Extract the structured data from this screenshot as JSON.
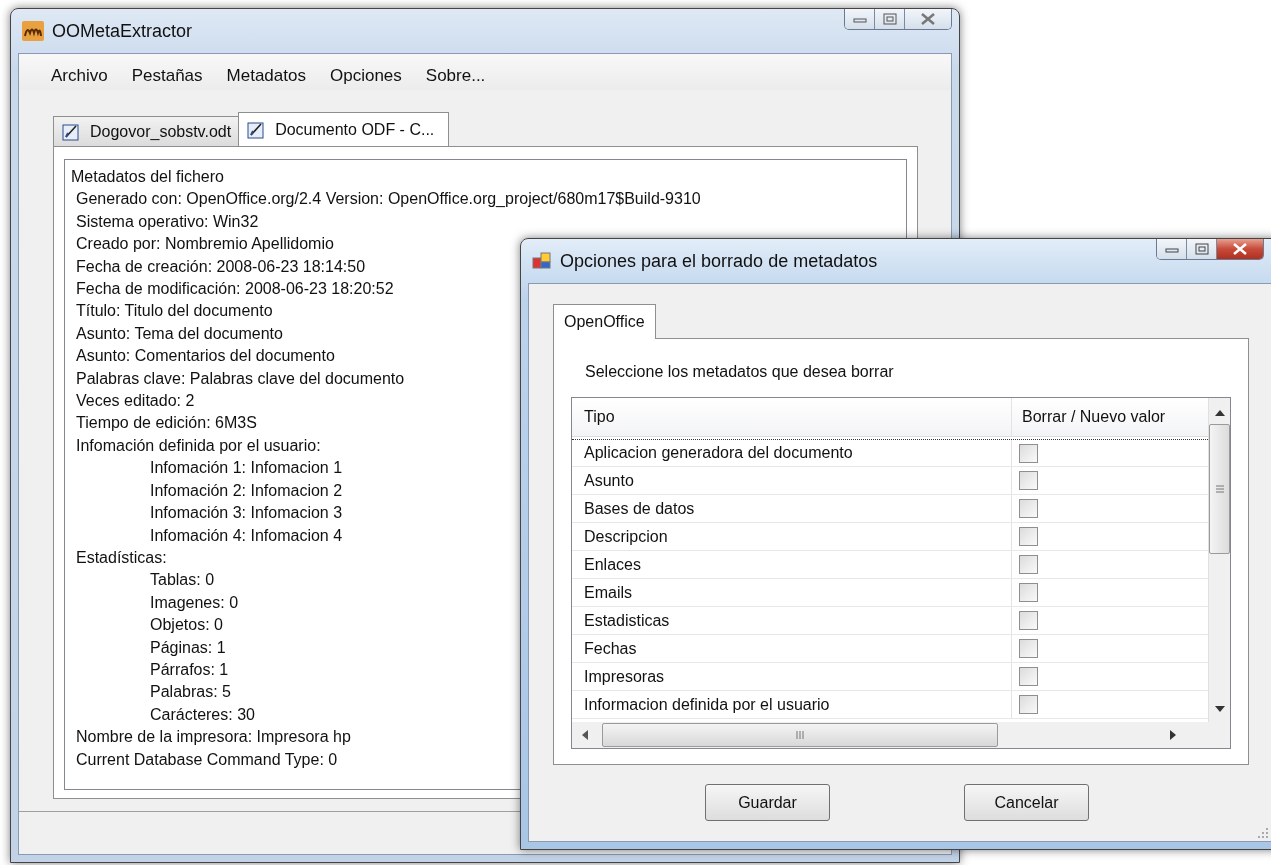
{
  "main_window": {
    "title": "OOMetaExtractor",
    "menu": [
      "Archivo",
      "Pestañas",
      "Metadatos",
      "Opciones",
      "Sobre..."
    ],
    "tabs": [
      {
        "label": "Dogovor_sobstv.odt",
        "selected": false
      },
      {
        "label": "Documento ODF - C...",
        "selected": true
      }
    ],
    "metadata": {
      "heading": "Metadatos del fichero",
      "lines": [
        {
          "text": "Generado con: OpenOffice.org/2.4 Version: OpenOffice.org_project/680m17$Build-9310"
        },
        {
          "text": "Sistema operativo: Win32"
        },
        {
          "text": "Creado por: Nombremio Apellidomio"
        },
        {
          "text": "Fecha de creación: 2008-06-23 18:14:50"
        },
        {
          "text": "Fecha de modificación: 2008-06-23 18:20:52"
        },
        {
          "text": "Título: Titulo del documento"
        },
        {
          "text": "Asunto: Tema del documento"
        },
        {
          "text": "Asunto: Comentarios del documento"
        },
        {
          "text": "Palabras clave: Palabras clave del documento"
        },
        {
          "text": "Veces editado: 2"
        },
        {
          "text": "Tiempo de edición:  6M3S"
        },
        {
          "text": "Infomación definida por el usuario:",
          "children": [
            {
              "text": "Infomación 1: Infomacion 1"
            },
            {
              "text": "Infomación 2: Infomacion 2"
            },
            {
              "text": "Infomación 3: Infomacion 3"
            },
            {
              "text": "Infomación 4: Infomacion 4"
            }
          ]
        },
        {
          "text": "Estadísticas:",
          "children": [
            {
              "text": "Tablas: 0"
            },
            {
              "text": "Imagenes: 0"
            },
            {
              "text": "Objetos: 0"
            },
            {
              "text": "Páginas: 1"
            },
            {
              "text": "Párrafos: 1"
            },
            {
              "text": "Palabras: 5"
            },
            {
              "text": "Carácteres: 30"
            }
          ]
        },
        {
          "text": "Nombre de la impresora: Impresora hp"
        },
        {
          "text": "Current Database Command Type: 0"
        }
      ]
    }
  },
  "dialog": {
    "title": "Opciones para el borrado de metadatos",
    "tabs": [
      {
        "label": "OpenOffice",
        "selected": true
      }
    ],
    "instruction": "Seleccione los metadatos que desea borrar",
    "table": {
      "columns": [
        "Tipo",
        "Borrar / Nuevo valor"
      ],
      "rows": [
        {
          "tipo": "Aplicacion generadora del documento",
          "checked": false
        },
        {
          "tipo": "Asunto",
          "checked": false
        },
        {
          "tipo": "Bases de datos",
          "checked": false
        },
        {
          "tipo": "Descripcion",
          "checked": false
        },
        {
          "tipo": "Enlaces",
          "checked": false
        },
        {
          "tipo": "Emails",
          "checked": false
        },
        {
          "tipo": "Estadisticas",
          "checked": false
        },
        {
          "tipo": "Fechas",
          "checked": false
        },
        {
          "tipo": "Impresoras",
          "checked": false
        },
        {
          "tipo": "Informacion definida por el usuario",
          "checked": false
        }
      ]
    },
    "buttons": [
      "Guardar",
      "Cancelar"
    ]
  }
}
